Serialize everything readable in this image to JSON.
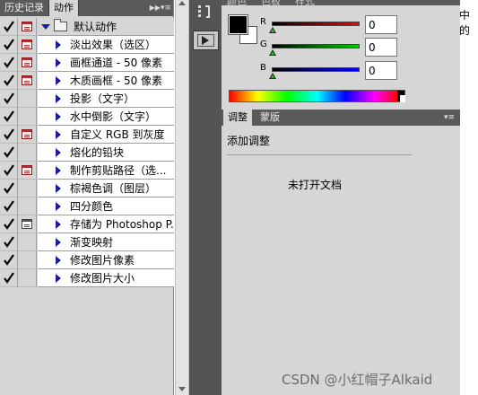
{
  "left_panel": {
    "tabs": [
      {
        "label": "历史记录",
        "active": false
      },
      {
        "label": "动作",
        "active": true
      }
    ],
    "collapse_icon": "double-chevron-right-icon",
    "menu_icon": "panel-menu-icon",
    "action_set": {
      "label": "默认动作",
      "expanded": true
    },
    "actions": [
      {
        "label": "淡出效果（选区）",
        "dialog": "red"
      },
      {
        "label": "画框通道 - 50 像素",
        "dialog": "red"
      },
      {
        "label": "木质画框 - 50 像素",
        "dialog": "red"
      },
      {
        "label": "投影（文字）",
        "dialog": "none"
      },
      {
        "label": "水中倒影（文字）",
        "dialog": "none"
      },
      {
        "label": "自定义 RGB 到灰度",
        "dialog": "red"
      },
      {
        "label": "熔化的铅块",
        "dialog": "none"
      },
      {
        "label": "制作剪贴路径（选...",
        "dialog": "red"
      },
      {
        "label": "棕褐色调（图层）",
        "dialog": "none"
      },
      {
        "label": "四分颜色",
        "dialog": "none"
      },
      {
        "label": "存储为 Photoshop P...",
        "dialog": "gray"
      },
      {
        "label": "渐变映射",
        "dialog": "none"
      },
      {
        "label": "修改图片像素",
        "dialog": "none"
      },
      {
        "label": "修改图片大小",
        "dialog": "none"
      }
    ]
  },
  "color_panel": {
    "tabs": [
      "颜色",
      "色板",
      "样式"
    ],
    "foreground": "#000000",
    "background": "#ffffff",
    "sliders": [
      {
        "channel": "R",
        "value": "0",
        "gradient_end": "#ff0000"
      },
      {
        "channel": "G",
        "value": "0",
        "gradient_end": "#00d000"
      },
      {
        "channel": "B",
        "value": "0",
        "gradient_end": "#0000ff"
      }
    ]
  },
  "adjust_panel": {
    "tabs": [
      {
        "label": "调整",
        "active": true
      },
      {
        "label": "蒙版",
        "active": false
      }
    ],
    "menu_icon": "panel-menu-icon",
    "title": "添加调整",
    "empty_message": "未打开文档"
  },
  "page": {
    "cut_text": "中的",
    "watermark": "CSDN @小红帽子Alkaid"
  }
}
